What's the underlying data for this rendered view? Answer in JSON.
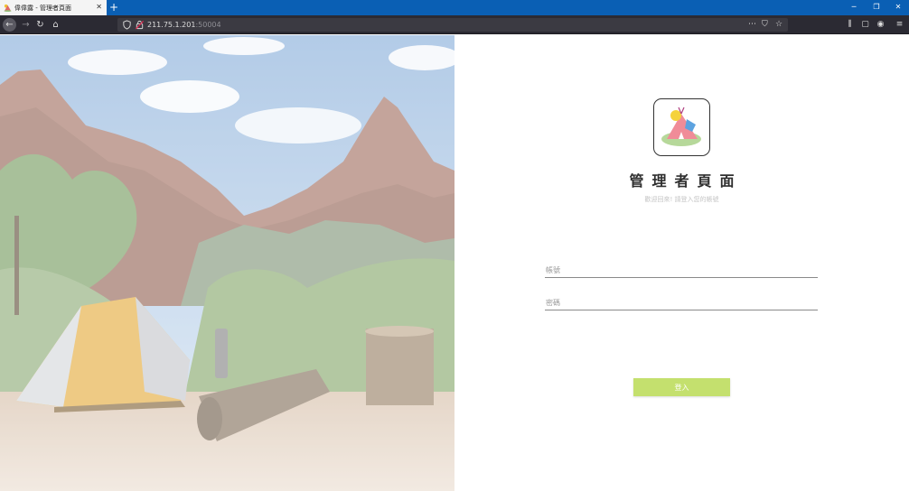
{
  "browser": {
    "tab": {
      "title": "偉偉露 - 管理者頁面"
    },
    "address": {
      "host": "211.75.1.201",
      "port": ":50004"
    }
  },
  "login": {
    "title": "管理者頁面",
    "subtitle": "歡迎回來! 請登入您的帳號",
    "username_placeholder": "帳號",
    "password_placeholder": "密碼",
    "submit_label": "登入"
  },
  "colors": {
    "accent_button": "#c4e06e",
    "tabbar": "#0a5fb4",
    "toolbar": "#2b2a33"
  }
}
